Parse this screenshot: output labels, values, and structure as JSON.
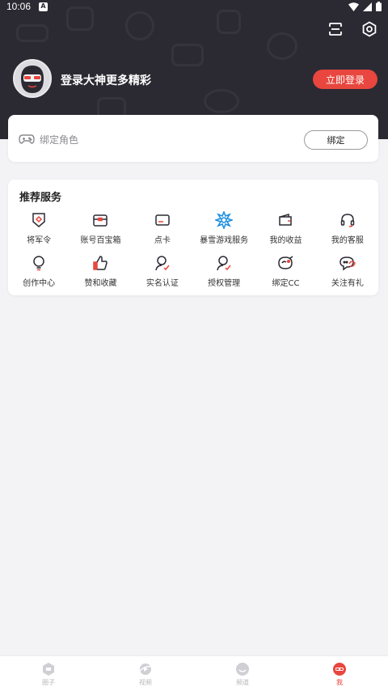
{
  "status_bar": {
    "time": "10:06",
    "notif_letter": "A"
  },
  "header": {
    "login_text": "登录大神更多精彩",
    "login_button": "立即登录"
  },
  "bind_card": {
    "label": "绑定角色",
    "button": "绑定"
  },
  "services": {
    "title": "推荐服务",
    "items": [
      {
        "label": "将军令",
        "icon": "shield-icon"
      },
      {
        "label": "账号百宝箱",
        "icon": "treasure-box-icon"
      },
      {
        "label": "点卡",
        "icon": "card-icon"
      },
      {
        "label": "暴雪游戏服务",
        "icon": "blizzard-icon"
      },
      {
        "label": "我的收益",
        "icon": "wallet-icon"
      },
      {
        "label": "我的客服",
        "icon": "headset-icon"
      },
      {
        "label": "创作中心",
        "icon": "lightbulb-icon"
      },
      {
        "label": "赞和收藏",
        "icon": "thumbs-up-icon"
      },
      {
        "label": "实名认证",
        "icon": "user-verified-icon"
      },
      {
        "label": "授权管理",
        "icon": "user-auth-icon"
      },
      {
        "label": "绑定CC",
        "icon": "cc-icon"
      },
      {
        "label": "关注有礼",
        "icon": "chat-gift-icon"
      }
    ]
  },
  "bottom_nav": [
    {
      "label": "圈子",
      "icon": "circle-icon",
      "active": false
    },
    {
      "label": "视频",
      "icon": "video-icon",
      "active": false
    },
    {
      "label": "频道",
      "icon": "channel-icon",
      "active": false
    },
    {
      "label": "我",
      "icon": "me-icon",
      "active": true
    }
  ],
  "colors": {
    "header_bg": "#2b2a33",
    "accent": "#e8463e",
    "page_bg": "#f3f3f5"
  }
}
